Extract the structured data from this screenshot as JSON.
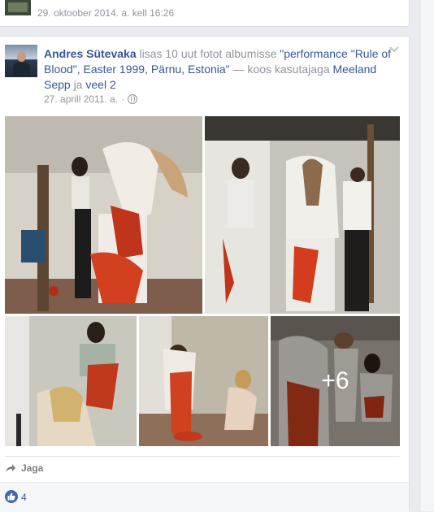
{
  "previous_post": {
    "time": "29. oktoober 2014. a. kell 16:26"
  },
  "post": {
    "author": "Andres Sütevaka",
    "action_text": " lisas 10 uut fotot albumisse ",
    "album_title": "\"performance \"Rule of Blood\", Easter 1999, Pärnu, Estonia\"",
    "with_text": " — koos kasutajaga ",
    "tagged_user": "Meeland Sepp",
    "and_text": " ja ",
    "others": "veel 2",
    "date": "27. aprill 2011. a.",
    "separator": "·",
    "more_photos": "+6",
    "share_label": "Jaga",
    "like_count": "4"
  },
  "colors": {
    "link": "#365899",
    "meta": "#90949c",
    "like_badge": "#4267b2"
  },
  "icons": [
    "globe-icon",
    "chevron-down-icon",
    "share-icon",
    "like-icon"
  ]
}
